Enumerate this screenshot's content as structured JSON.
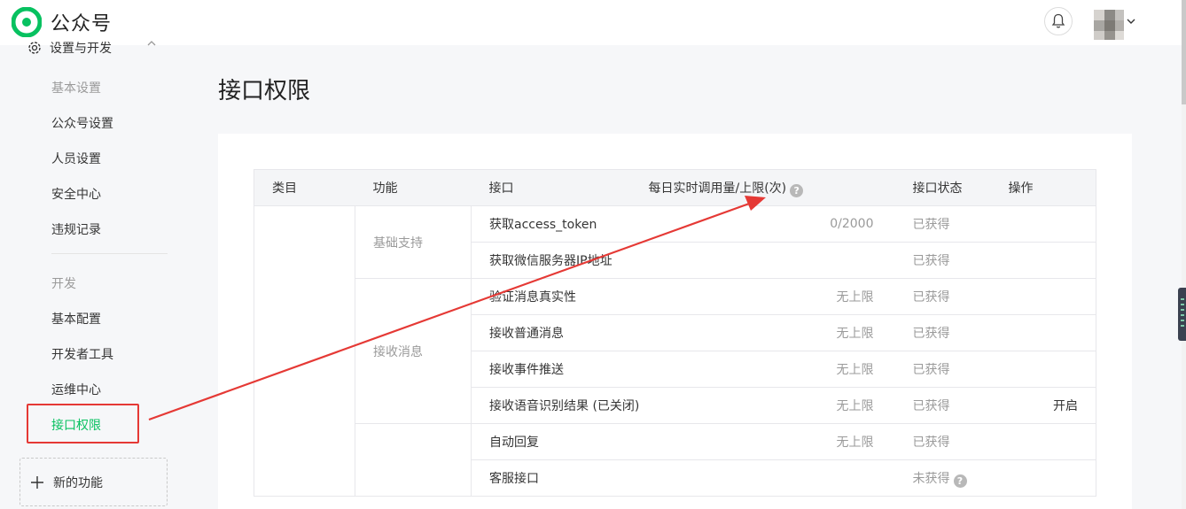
{
  "header": {
    "brand": "公众号",
    "bell_icon": "bell-icon",
    "account_menu_icon": "chevron-down-icon",
    "accent": "#07c160"
  },
  "sidebar": {
    "section_title": "设置与开发",
    "groups": [
      {
        "label": "基本设置",
        "items": [
          "公众号设置",
          "人员设置",
          "安全中心",
          "违规记录"
        ]
      },
      {
        "label": "开发",
        "items": [
          "基本配置",
          "开发者工具",
          "运维中心",
          "接口权限"
        ]
      }
    ],
    "active_item": "接口权限",
    "new_feature": "新的功能"
  },
  "main": {
    "title": "接口权限",
    "table": {
      "headers": [
        "类目",
        "功能",
        "接口",
        "每日实时调用量/上限(次)",
        "接口状态",
        "操作"
      ],
      "rows": [
        {
          "function": "基础支持",
          "api": "获取access_token",
          "limit": "0/2000",
          "status": "已获得",
          "op": ""
        },
        {
          "function": "",
          "api": "获取微信服务器IP地址",
          "limit": "",
          "status": "已获得",
          "op": ""
        },
        {
          "function": "接收消息",
          "api": "验证消息真实性",
          "limit": "无上限",
          "status": "已获得",
          "op": ""
        },
        {
          "function": "",
          "api": "接收普通消息",
          "limit": "无上限",
          "status": "已获得",
          "op": ""
        },
        {
          "function": "",
          "api": "接收事件推送",
          "limit": "无上限",
          "status": "已获得",
          "op": ""
        },
        {
          "function": "",
          "api": "接收语音识别结果 (已关闭)",
          "limit": "无上限",
          "status": "已获得",
          "op": "开启"
        },
        {
          "function": "",
          "api": "自动回复",
          "limit": "无上限",
          "status": "已获得",
          "op": ""
        },
        {
          "function": "",
          "api": "客服接口",
          "limit": "",
          "status": "未获得",
          "op": ""
        }
      ]
    }
  },
  "annotation": {
    "color": "#e53935"
  }
}
